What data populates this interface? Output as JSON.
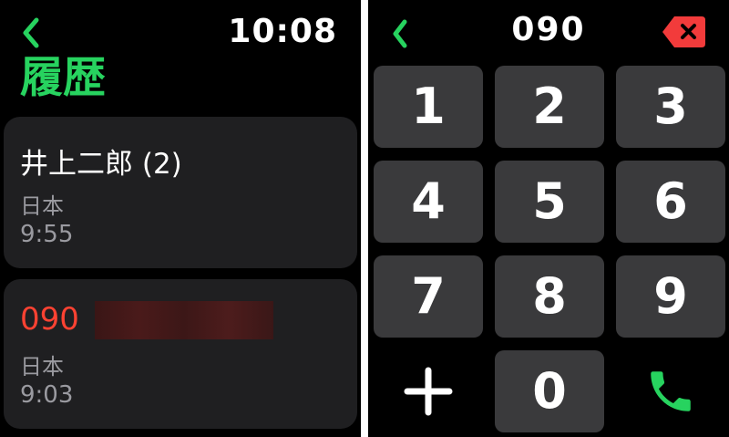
{
  "history": {
    "time": "10:08",
    "title": "履歴",
    "entries": [
      {
        "name": "井上二郎 (2)",
        "region": "日本",
        "time": "9:55"
      },
      {
        "number": "090",
        "region": "日本",
        "time": "9:03"
      }
    ]
  },
  "keypad": {
    "dialed": "090",
    "keys": [
      "1",
      "2",
      "3",
      "4",
      "5",
      "6",
      "7",
      "8",
      "9",
      "0"
    ],
    "icons": {
      "back": "chevron-left-icon",
      "delete": "delete-backspace-icon",
      "plus": "plus-icon",
      "call": "phone-icon"
    }
  },
  "colors": {
    "accent": "#27d35f",
    "missed": "#fc4232",
    "card_bg": "#1f1f21",
    "key_bg": "#3a3a3c",
    "delete_red": "#f23b3b",
    "secondary_text": "#9a9aa0"
  }
}
